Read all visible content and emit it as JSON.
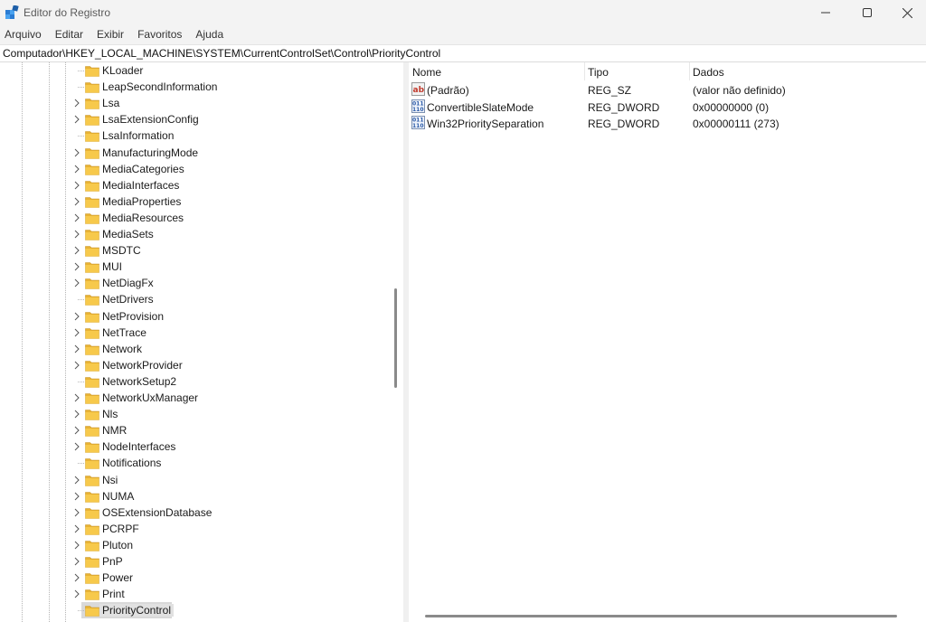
{
  "window": {
    "title": "Editor do Registro",
    "icon": "registry-editor-icon"
  },
  "menu": [
    "Arquivo",
    "Editar",
    "Exibir",
    "Favoritos",
    "Ajuda"
  ],
  "address": "Computador\\HKEY_LOCAL_MACHINE\\SYSTEM\\CurrentControlSet\\Control\\PriorityControl",
  "tree": [
    {
      "label": "KLoader",
      "expandable": false
    },
    {
      "label": "LeapSecondInformation",
      "expandable": false
    },
    {
      "label": "Lsa",
      "expandable": true
    },
    {
      "label": "LsaExtensionConfig",
      "expandable": true
    },
    {
      "label": "LsaInformation",
      "expandable": false
    },
    {
      "label": "ManufacturingMode",
      "expandable": true
    },
    {
      "label": "MediaCategories",
      "expandable": true
    },
    {
      "label": "MediaInterfaces",
      "expandable": true
    },
    {
      "label": "MediaProperties",
      "expandable": true
    },
    {
      "label": "MediaResources",
      "expandable": true
    },
    {
      "label": "MediaSets",
      "expandable": true
    },
    {
      "label": "MSDTC",
      "expandable": true
    },
    {
      "label": "MUI",
      "expandable": true
    },
    {
      "label": "NetDiagFx",
      "expandable": true
    },
    {
      "label": "NetDrivers",
      "expandable": false
    },
    {
      "label": "NetProvision",
      "expandable": true
    },
    {
      "label": "NetTrace",
      "expandable": true
    },
    {
      "label": "Network",
      "expandable": true
    },
    {
      "label": "NetworkProvider",
      "expandable": true
    },
    {
      "label": "NetworkSetup2",
      "expandable": false
    },
    {
      "label": "NetworkUxManager",
      "expandable": true
    },
    {
      "label": "Nls",
      "expandable": true
    },
    {
      "label": "NMR",
      "expandable": true
    },
    {
      "label": "NodeInterfaces",
      "expandable": true
    },
    {
      "label": "Notifications",
      "expandable": false
    },
    {
      "label": "Nsi",
      "expandable": true
    },
    {
      "label": "NUMA",
      "expandable": true
    },
    {
      "label": "OSExtensionDatabase",
      "expandable": true
    },
    {
      "label": "PCRPF",
      "expandable": true
    },
    {
      "label": "Pluton",
      "expandable": true
    },
    {
      "label": "PnP",
      "expandable": true
    },
    {
      "label": "Power",
      "expandable": true
    },
    {
      "label": "Print",
      "expandable": true
    },
    {
      "label": "PriorityControl",
      "expandable": false,
      "selected": true
    }
  ],
  "values": {
    "columns": [
      "Nome",
      "Tipo",
      "Dados"
    ],
    "rows": [
      {
        "name": "(Padrão)",
        "type": "REG_SZ",
        "data": "(valor não definido)",
        "icon": "string-value-icon"
      },
      {
        "name": "ConvertibleSlateMode",
        "type": "REG_DWORD",
        "data": "0x00000000 (0)",
        "icon": "binary-value-icon"
      },
      {
        "name": "Win32PrioritySeparation",
        "type": "REG_DWORD",
        "data": "0x00000111 (273)",
        "icon": "binary-value-icon"
      }
    ]
  },
  "colors": {
    "folder": "#f7c94b",
    "selection": "#d9d9d9"
  }
}
